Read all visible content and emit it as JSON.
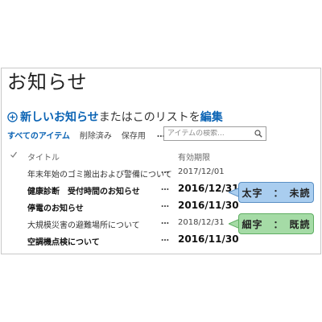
{
  "page": {
    "title": "お知らせ"
  },
  "new_item": {
    "new_label": "新しいお知らせ",
    "middle_text": "またはこのリストを",
    "edit_label": "編集"
  },
  "views": {
    "items": [
      "すべてのアイテム",
      "削除済み",
      "保存用"
    ],
    "more": "…"
  },
  "search": {
    "placeholder": "アイテムの検索..."
  },
  "columns": {
    "title": "タイトル",
    "expiry": "有効期限"
  },
  "rows": [
    {
      "title": "年末年始のゴミ搬出および警備について",
      "expiry": "2017/12/01",
      "unread": false
    },
    {
      "title": "健康診断　受付時間のお知らせ",
      "expiry": "2016/12/31",
      "unread": true
    },
    {
      "title": "停電のお知らせ",
      "expiry": "2016/11/30",
      "unread": true
    },
    {
      "title": "大規模災害の避難場所について",
      "expiry": "2018/12/31",
      "unread": false
    },
    {
      "title": "空調機点検について",
      "expiry": "2016/11/30",
      "unread": true
    }
  ],
  "row_menu": "…",
  "callouts": {
    "bold": "太字　：　未読",
    "thin": "細字　：　既読",
    "bold_color": "#a9cdef",
    "thin_color": "#a5dba6"
  },
  "colors": {
    "accent": "#0a63b4"
  }
}
